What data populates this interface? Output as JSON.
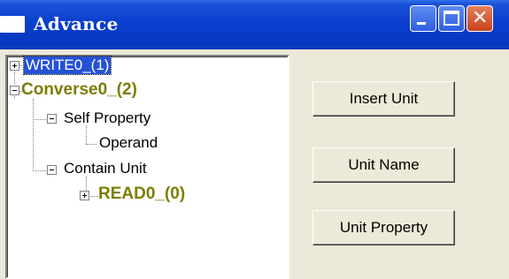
{
  "window": {
    "title": "Advance",
    "colors": {
      "title_bar": "#0a3fcf",
      "selection": "#2552d6",
      "unit_text": "#7d7d00",
      "close_button": "#c8421b"
    }
  },
  "titlebar_buttons": {
    "minimize_icon": "minimize-icon",
    "maximize_icon": "maximize-icon",
    "close_glyph": "✕"
  },
  "tree": {
    "nodes": [
      {
        "label": "WRITE0_(1)",
        "expander": "+",
        "state": "collapsed",
        "selected": true
      },
      {
        "label": "Converse0_(2)",
        "expander": "−",
        "state": "expanded",
        "style": "bold"
      },
      {
        "label": "Self Property",
        "expander": "−",
        "state": "expanded"
      },
      {
        "label": "Operand"
      },
      {
        "label": "Contain Unit",
        "expander": "−",
        "state": "expanded"
      },
      {
        "label": "READ0_(0)",
        "expander": "+",
        "state": "collapsed",
        "style": "bold"
      }
    ]
  },
  "buttons": {
    "insert_unit": "Insert Unit",
    "unit_name": "Unit Name",
    "unit_property": "Unit Property"
  }
}
